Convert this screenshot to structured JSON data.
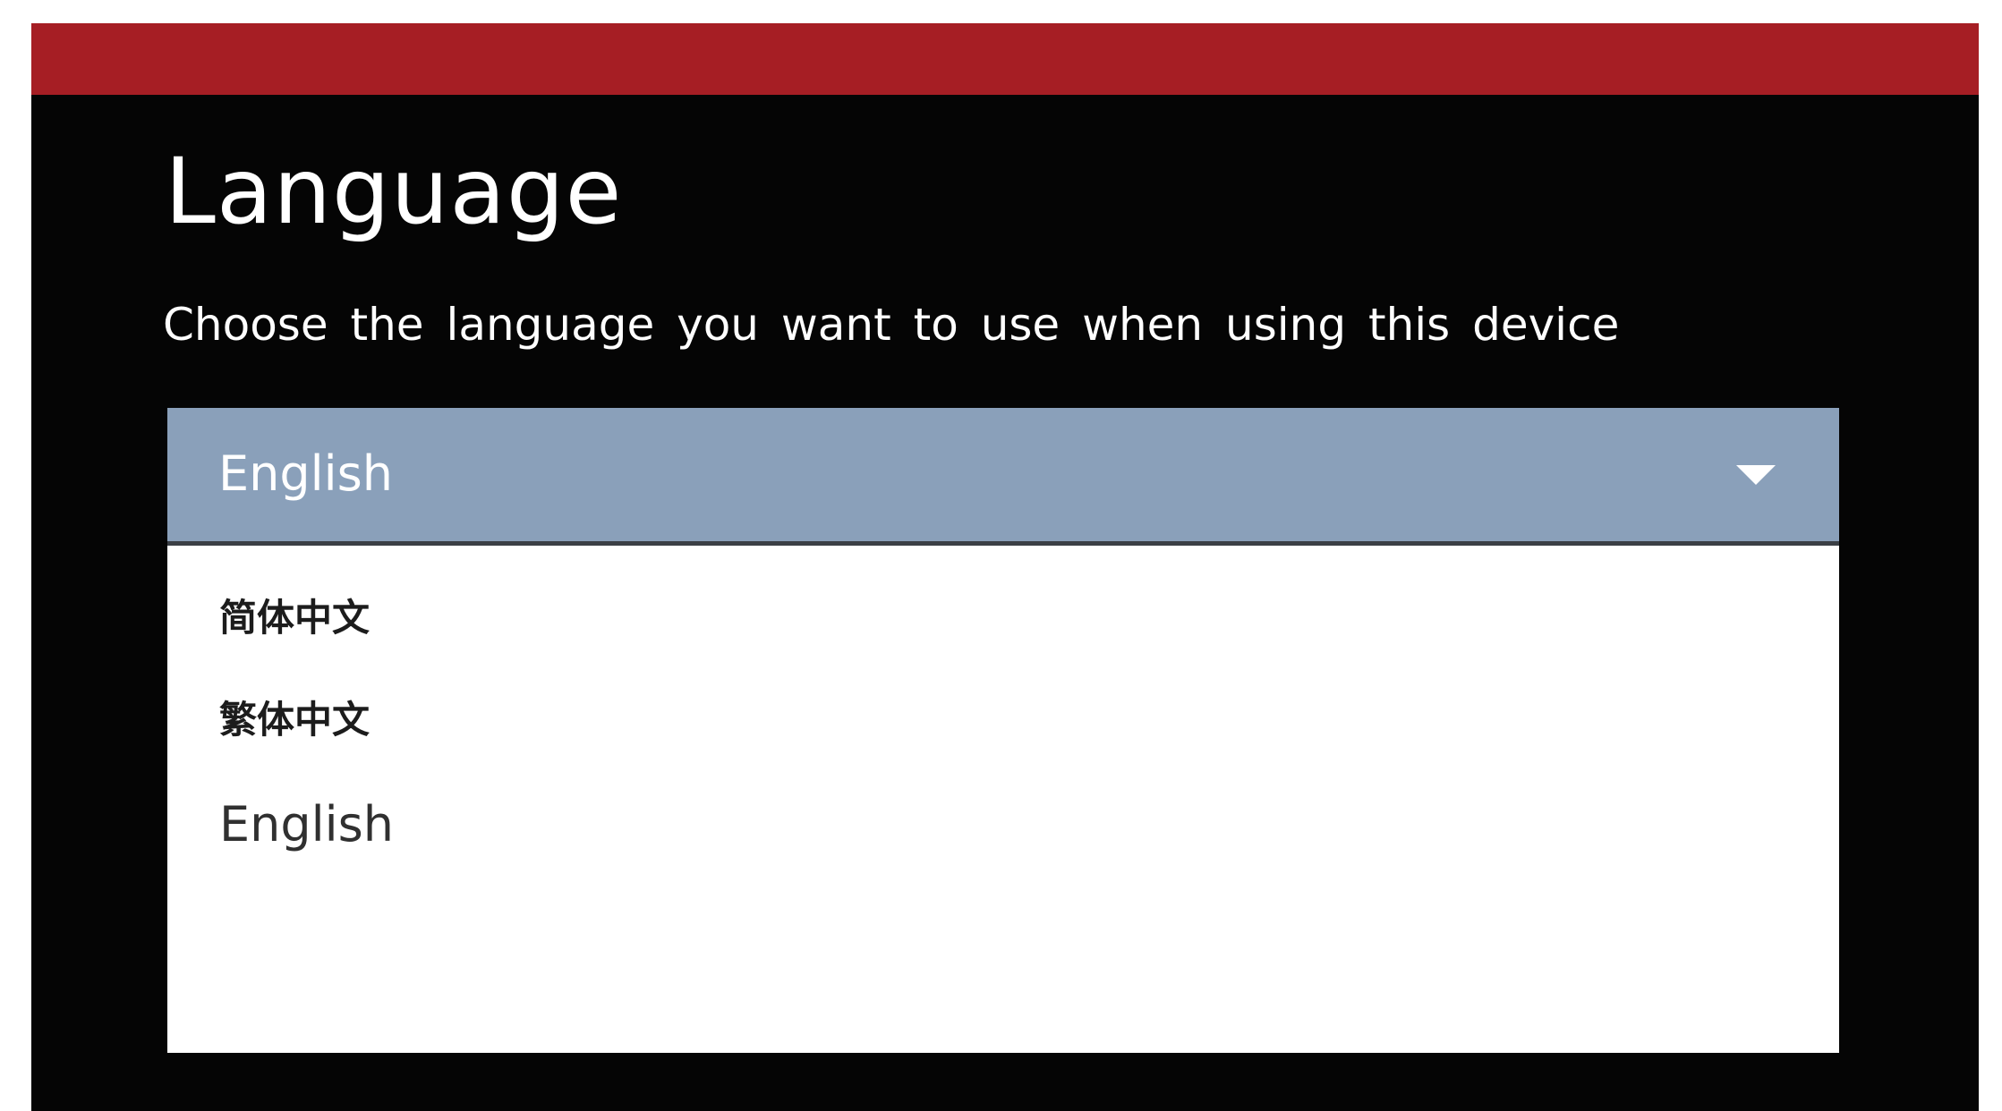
{
  "header": {
    "title": "Language",
    "subtitle": "Choose the language you want to use when using this device",
    "accent_color": "#a61e24"
  },
  "language_select": {
    "selected": "English",
    "select_color": "#8aa0ba",
    "caret_icon": "caret-down-icon",
    "options": [
      {
        "label": "简体中文"
      },
      {
        "label": "繁体中文"
      },
      {
        "label": "English"
      }
    ]
  }
}
